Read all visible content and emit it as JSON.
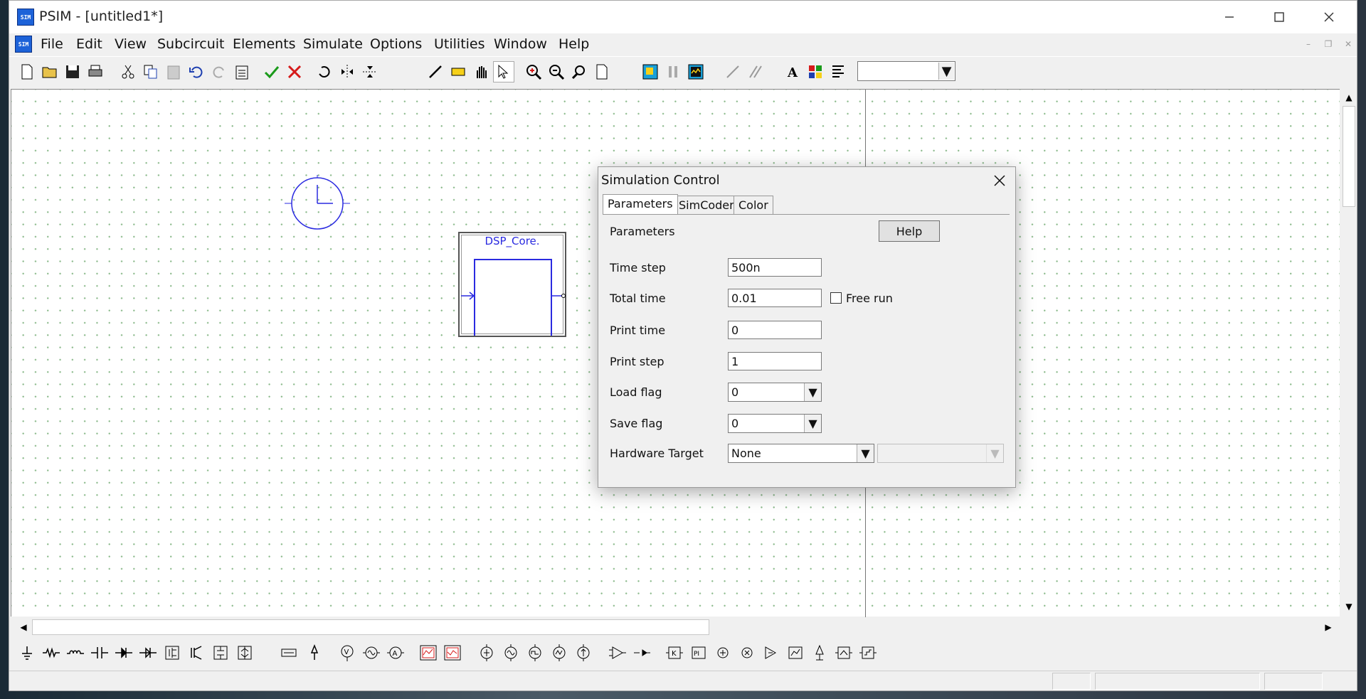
{
  "window": {
    "title": "PSIM - [untitled1*]",
    "app_icon_glyph": "SIM"
  },
  "menu": {
    "items": [
      "File",
      "Edit",
      "View",
      "Subcircuit",
      "Elements",
      "Simulate",
      "Options",
      "Utilities",
      "Window",
      "Help"
    ]
  },
  "schematic": {
    "block_label": "DSP_Core."
  },
  "dialog": {
    "title": "Simulation Control",
    "tabs": [
      "Parameters",
      "SimCoder",
      "Color"
    ],
    "section_label": "Parameters",
    "help_label": "Help",
    "time_step": {
      "label": "Time step",
      "value": "500n"
    },
    "total_time": {
      "label": "Total time",
      "value": "0.01"
    },
    "free_run": {
      "label": "Free run",
      "checked": false
    },
    "print_time": {
      "label": "Print time",
      "value": "0"
    },
    "print_step": {
      "label": "Print step",
      "value": "1"
    },
    "load_flag": {
      "label": "Load flag",
      "value": "0"
    },
    "save_flag": {
      "label": "Save flag",
      "value": "0"
    },
    "hardware_target": {
      "label": "Hardware Target",
      "value": "None",
      "secondary_value": ""
    }
  },
  "colors": {
    "accent": "#1d62d8",
    "schematic": "#2a2ae0",
    "grid_dot": "#8ab98a"
  }
}
